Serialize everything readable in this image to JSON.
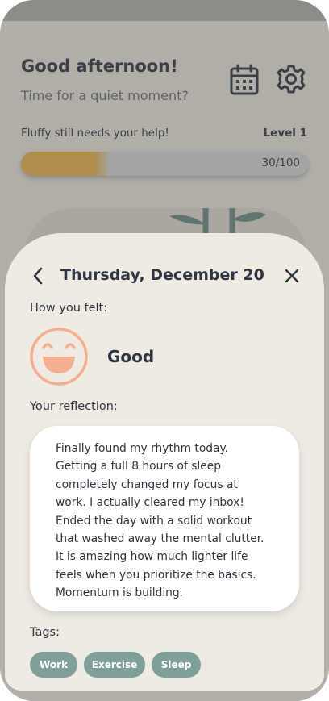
{
  "home": {
    "greeting": "Good afternoon!",
    "subgreeting": "Time for a quiet moment?",
    "progress_label": "Fluffy still needs your help!",
    "level_label": "Level 1",
    "progress_text": "30/100",
    "progress_value": 30,
    "progress_max": 100,
    "icons": [
      "calendar-icon",
      "gear-icon"
    ]
  },
  "entry": {
    "date_title": "Thursday, December 20",
    "felt_label": "How you felt:",
    "mood": {
      "icon": "laughing-face-icon",
      "label": "Good"
    },
    "reflection_label": "Your reflection:",
    "reflection_text": "Finally found my rhythm today.\nGetting a full 8 hours of sleep\ncompletely changed my focus at\nwork. I actually cleared my inbox!\nEnded the day with a solid workout\nthat washed away the mental clutter.\nIt is amazing how much lighter life\nfeels when you prioritize the basics.\nMomentum is building.",
    "tags_label": "Tags:",
    "tags": [
      "Work",
      "Exercise",
      "Sleep"
    ]
  },
  "colors": {
    "background": "#f2ede3",
    "text": "#2f3540",
    "progress_fill": "#f0b84a",
    "tag": "#7e9f9a",
    "mood": "#f4b08e"
  }
}
